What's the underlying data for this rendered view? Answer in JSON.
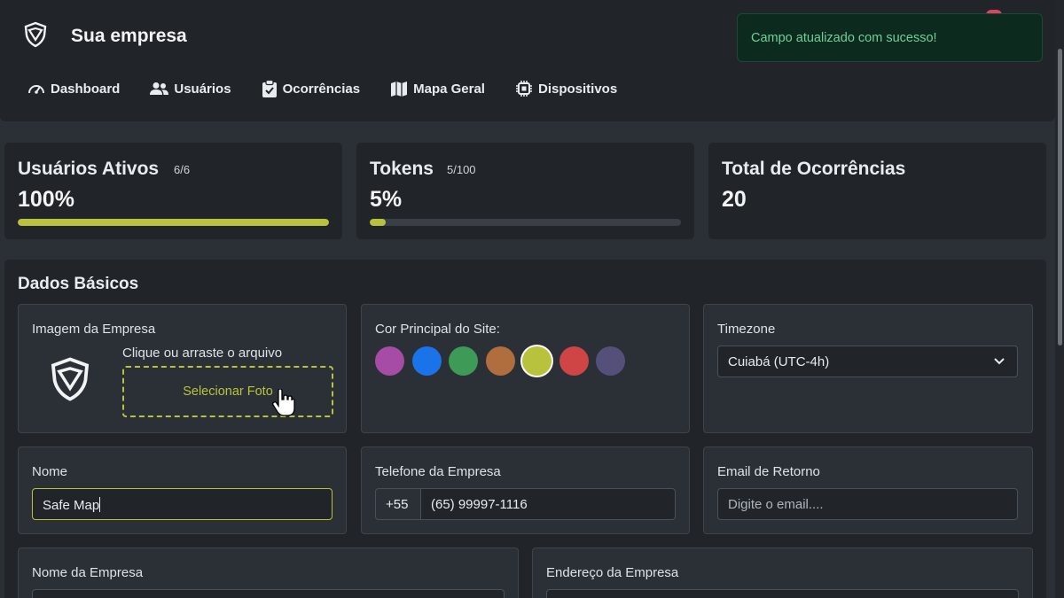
{
  "header": {
    "brand_name": "Sua empresa",
    "nav": [
      {
        "label": "Dashboard",
        "icon": "gauge-icon"
      },
      {
        "label": "Usuários",
        "icon": "users-icon"
      },
      {
        "label": "Ocorrências",
        "icon": "clipboard-check-icon"
      },
      {
        "label": "Mapa Geral",
        "icon": "map-icon"
      },
      {
        "label": "Dispositivos",
        "icon": "cpu-icon"
      }
    ]
  },
  "toast": {
    "message": "Campo atualizado com sucesso!"
  },
  "stats": {
    "users": {
      "title": "Usuários Ativos",
      "sub": "6/6",
      "value": "100%",
      "progress": 1.0
    },
    "tokens": {
      "title": "Tokens",
      "sub": "5/100",
      "value": "5%",
      "progress": 0.05
    },
    "occurrences": {
      "title": "Total de Ocorrências",
      "value": "20"
    }
  },
  "basic": {
    "title": "Dados Básicos",
    "image": {
      "label": "Imagem da Empresa",
      "hint": "Clique ou arraste o arquivo",
      "button": "Selecionar Foto"
    },
    "color": {
      "label": "Cor Principal do Site:",
      "swatches": [
        "#a64ca6",
        "#1a73e8",
        "#3d9a57",
        "#b06d3d",
        "#b8c23d",
        "#cf4444",
        "#55507a"
      ],
      "selected": "#b8c23d"
    },
    "timezone": {
      "label": "Timezone",
      "value": "Cuiabá (UTC-4h)"
    },
    "name": {
      "label": "Nome",
      "value": "Safe Map"
    },
    "phone": {
      "label": "Telefone da Empresa",
      "prefix": "+55",
      "value": "(65) 99997-1116"
    },
    "email": {
      "label": "Email de Retorno",
      "placeholder": "Digite o email...."
    },
    "company_name": {
      "label": "Nome da Empresa"
    },
    "company_address": {
      "label": "Endereço da Empresa"
    }
  },
  "colors": {
    "accent": "#b8c23d",
    "success_text": "#6fcf97"
  }
}
